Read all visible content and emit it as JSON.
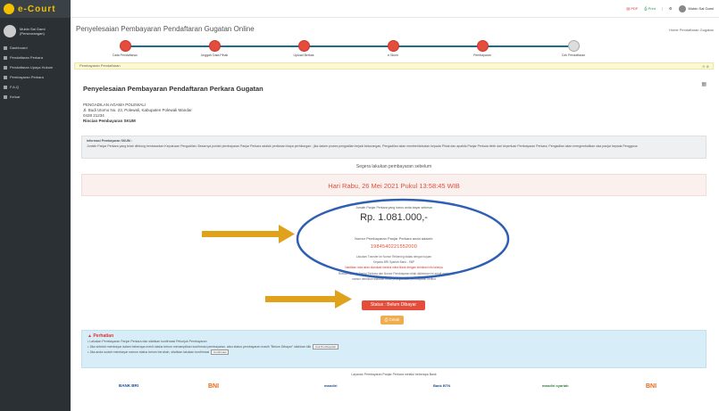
{
  "app": {
    "logo": "e-Court"
  },
  "user": {
    "name": "Mubin Sal Gami",
    "role": "(Perseorangan)"
  },
  "sidebar": {
    "items": [
      {
        "label": "Dashboard"
      },
      {
        "label": "Pendaftaran Perkara"
      },
      {
        "label": "Pendaftaran Upaya Hukum"
      },
      {
        "label": "Pembayaran Perkara"
      },
      {
        "label": "F.A.Q"
      },
      {
        "label": "Keluar"
      }
    ]
  },
  "topbar": {
    "pdf": "PDF",
    "print": "Print",
    "user": "Mubin Sal Gami"
  },
  "page": {
    "title": "Penyelesaian Pembayaran Pendaftaran Gugatan Online",
    "breadcrumb": "Home   Pendaftaran   Gugatan"
  },
  "steps": [
    {
      "label": "Data Pendaftaran",
      "state": "done"
    },
    {
      "label": "Unggah Data Pihak",
      "state": "done"
    },
    {
      "label": "Upload Berkas",
      "state": "done"
    },
    {
      "label": "e-Skum",
      "state": "done"
    },
    {
      "label": "Pembayaran",
      "state": "done"
    },
    {
      "label": "Cek Pendaftaran",
      "state": "pending"
    }
  ],
  "yellowbar": {
    "label": "Pembayaran Pendaftaran"
  },
  "main": {
    "heading": "Penyelesaian Pembayaran Pendaftaran Perkara Gugatan",
    "court": "PENGADILAN AGAMA POLEWALI",
    "address": "Jl. Budi Utomo No. 23, Polewali, Kabupaten Polewali Mandar",
    "phone": "0428 21234",
    "rincian": "Rincian Pembayaran SKUM",
    "info_title": "Informasi Pembayaran SKUM :",
    "info_text": "Jumlah Panjar Perkara yang telah dihitung berdasarkan Keputusan Pengadilan. Besarnya jumlah pembayaran Panjar Perkara adalah perkiraan biaya perhitungan ; jika dalam proses pengadilan terjadi kekurangan, Pengadilan akan memberitahukan kepada Pihak dan apabila Panjar Perkara lebih dari keperluan Pembayaran Perkara, Pengadilan akan mengembalikan sisa panjar kepada Pengguna.",
    "segera": "Segera lakukan pembayaran sebelum",
    "deadline": "Hari Rabu, 26 Mei 2021 Pukul 13:58:45 WIB",
    "amount_label": "Jumlah Panjar Perkara yang harus anda bayar sebesar",
    "amount": "Rp. 1.081.000,-",
    "nomor_label": "Nomor Pembayaran Panjar Perkara anda adalah:",
    "nomor": "1984540221552000",
    "line1": "Lakukan Transfer ke Nomor Rekening diatas dengan tujuan",
    "line2": "Kepada BRI Syariah Bank - SBP",
    "line3": "Nantikan nota akan dianulasi melalui mitra Bank dengan kirimkan info lainnya",
    "line4": "Rincian Jumlah Panjar Perkara dan Nomor Pembayaran telah dikirimkan ke email anda,",
    "line5": "namun demikian silahkan cetak petunjuk atau pembayaran berikut",
    "status": "Status : Belum Dibayar",
    "cetak": "Cetak",
    "perhatian_title": "Perhatian",
    "perhatian_1": "Lakukan Pembayaran Panjar Perkara dan silahkan konfirmasi Petunjuk Pembayaran",
    "perhatian_2": "Jika setelah membayar dalam beberapa menit status belum menampilkan konfirmasi pembayaran, atau status pembayaran masih \"Belum Dibayar\" silahkan klik",
    "perhatian_2_btn": "Cek Pembayaran",
    "perhatian_3": "Jika anda sudah membayar namun status belum berubah, silahkan lakukan konfirmasi",
    "perhatian_3_btn": "Konfirmasi",
    "banks_title": "Layanan Pembayaran Panjar Perkara melalui beberapa Bank",
    "banks": [
      "BANK BRI",
      "BNI",
      "mandiri",
      "Bank BTN",
      "mandiri syariah",
      "BNI"
    ]
  },
  "colors": {
    "sidebar": "#2b3035",
    "accent_red": "#e44d3a",
    "step_line": "#1a6f8f",
    "info_blue": "#d7edf7",
    "annotation_arrow": "#e0a11b",
    "annotation_ellipse": "#2f5fb3"
  }
}
